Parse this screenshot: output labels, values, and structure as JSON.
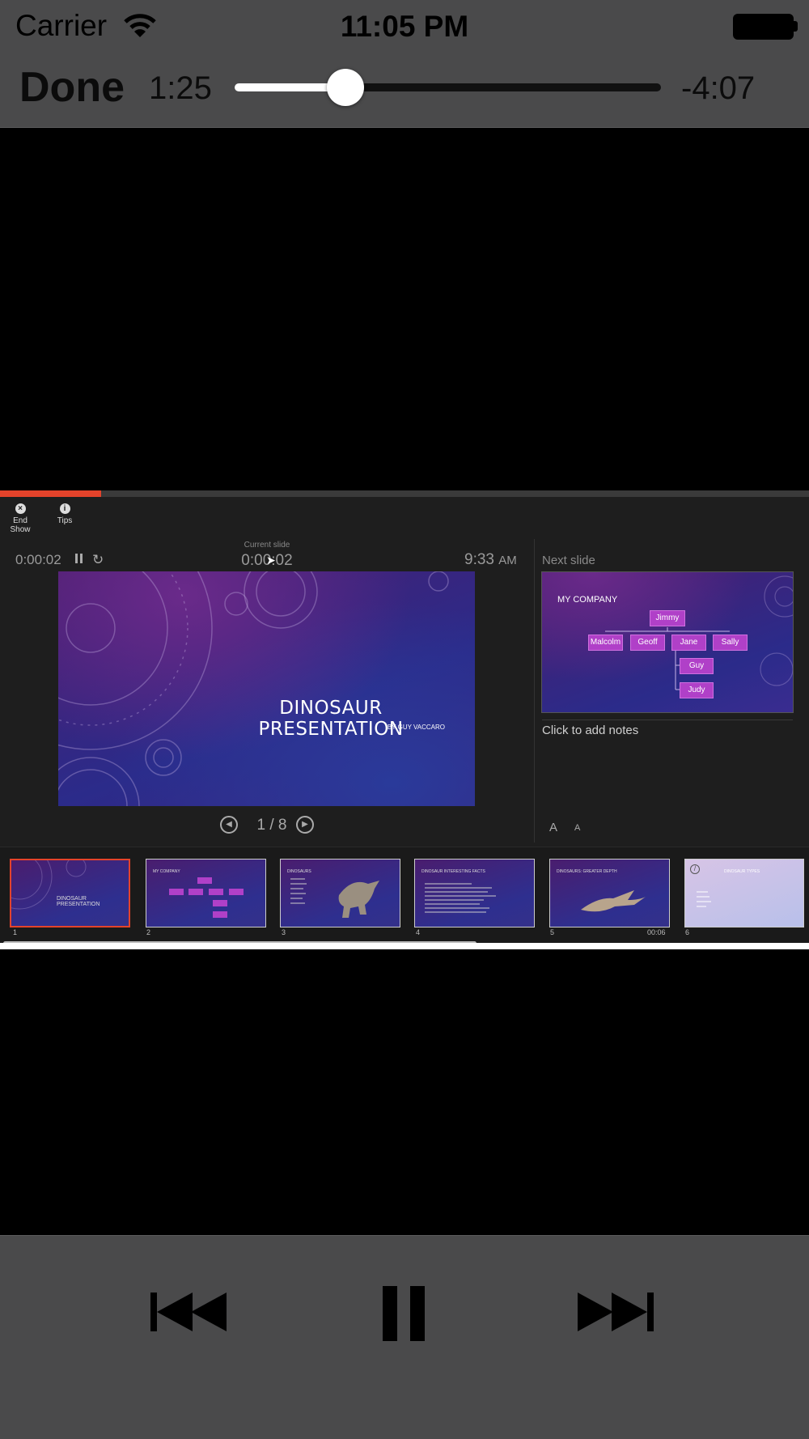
{
  "status_bar": {
    "carrier": "Carrier",
    "time": "11:05 PM"
  },
  "player": {
    "done_label": "Done",
    "elapsed": "1:25",
    "remaining": "-4:07",
    "progress_fraction": 0.26
  },
  "presenter": {
    "progress_fraction": 0.125,
    "toolbar": {
      "end_show_label": "End Show",
      "tips_label": "Tips"
    },
    "timer": "0:00:02",
    "current_slide_label": "Current slide",
    "current_slide_time": "0:00:02",
    "clock_time": "9:33",
    "clock_ampm": "AM",
    "current_slide": {
      "title": "DINOSAUR PRESENTATION",
      "subtitle": "BY GUY VACCARO"
    },
    "slide_counter": "1 / 8",
    "next_slide_label": "Next slide",
    "next_slide": {
      "title": "MY COMPANY",
      "org": [
        "Jimmy",
        "Malcolm",
        "Geoff",
        "Jane",
        "Sally",
        "Guy",
        "Judy"
      ]
    },
    "notes_placeholder": "Click to add notes",
    "font_increase": "A",
    "font_decrease": "A",
    "thumbnails": [
      {
        "number": "1",
        "title": "DINOSAUR PRESENTATION",
        "time": ""
      },
      {
        "number": "2",
        "title": "MY COMPANY",
        "time": ""
      },
      {
        "number": "3",
        "title": "DINOSAURS",
        "time": ""
      },
      {
        "number": "4",
        "title": "DINOSAUR INTERESTING FACTS",
        "time": ""
      },
      {
        "number": "5",
        "title": "DINOSAURS: GREATER DEPTH",
        "time": "00:06"
      },
      {
        "number": "6",
        "title": "DINOSAUR TYPES",
        "time": ""
      }
    ]
  },
  "colors": {
    "accent": "#e4432b",
    "chrome": "#4a4a4b",
    "org_box": "#b040c8"
  },
  "icons": [
    "wifi-icon",
    "battery-icon",
    "end-show-icon",
    "tips-icon",
    "pause-icon",
    "restart-icon",
    "previous-slide-icon",
    "next-slide-icon",
    "skip-back-icon",
    "pause-icon",
    "skip-forward-icon"
  ]
}
